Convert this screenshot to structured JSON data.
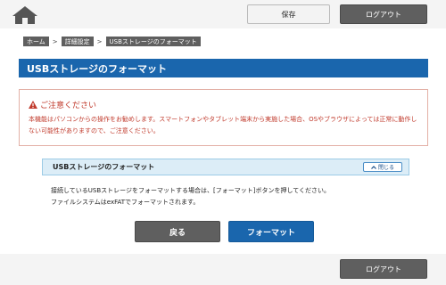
{
  "header": {
    "home_icon": "home-icon",
    "save_label": "保存",
    "logout_label": "ログアウト"
  },
  "breadcrumb": {
    "items": [
      "ホーム",
      "詳細設定",
      "USBストレージのフォーマット"
    ],
    "separator": ">"
  },
  "page": {
    "title": "USBストレージのフォーマット"
  },
  "notice": {
    "icon": "warning-icon",
    "title": "ご注意ください",
    "body": "本機能はパソコンからの操作をお勧めします。スマートフォンやタブレット端末から実施した場合、OSやブラウザによっては正常に動作しない可能性がありますので、ご注意ください。"
  },
  "section": {
    "title": "USBストレージのフォーマット",
    "close_label": "閉じる",
    "close_icon": "chevron-up-icon",
    "description_line1": "接続しているUSBストレージをフォーマットする場合は、[フォーマット]ボタンを押してください。",
    "description_line2": "ファイルシステムはexFATでフォーマットされます。"
  },
  "actions": {
    "back_label": "戻る",
    "format_label": "フォーマット"
  },
  "footer": {
    "logout_label": "ログアウト"
  },
  "colors": {
    "primary": "#1a66ad",
    "dark_button": "#5f5f5f",
    "warning": "#c0392b",
    "section_bg": "#dcedf7"
  }
}
